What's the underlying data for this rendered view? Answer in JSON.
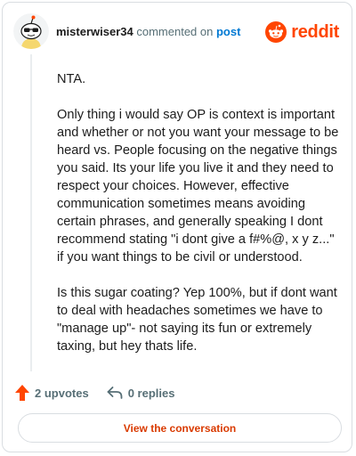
{
  "header": {
    "username": "misterwiser34",
    "action_text": "commented on",
    "post_link": "post",
    "brand_name": "reddit"
  },
  "comment": {
    "paragraphs": [
      "NTA.",
      "Only thing i would say OP is context is important and whether or not you want your message to be heard vs. People focusing on the negative things you said. Its your life you live it and they need to respect your choices. However, effective communication sometimes means avoiding certain phrases, and generally speaking I dont recommend stating \"i dont give a f#%@, x y z...\" if you want things to be civil or understood.",
      "Is this sugar coating? Yep 100%, but if dont want to deal with headaches sometimes we have to \"manage up\"- not saying its fun or extremely taxing, but hey thats life."
    ]
  },
  "actions": {
    "upvotes": "2 upvotes",
    "replies": "0 replies"
  },
  "cta": {
    "label": "View the conversation"
  },
  "colors": {
    "brand": "#ff4500",
    "link": "#0079d3",
    "cta_text": "#d93a00",
    "muted": "#576f76"
  }
}
